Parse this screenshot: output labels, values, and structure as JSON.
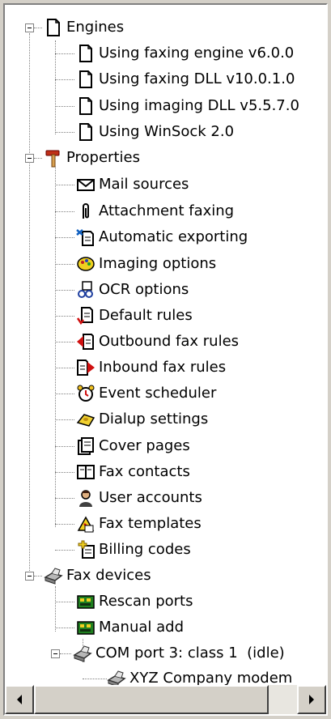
{
  "tree": {
    "engines": {
      "label": "Engines",
      "children": [
        {
          "label": "Using faxing engine v6.0.0",
          "icon": "document-icon"
        },
        {
          "label": "Using faxing DLL v10.0.1.0",
          "icon": "document-icon"
        },
        {
          "label": "Using imaging DLL v5.5.7.0",
          "icon": "document-icon"
        },
        {
          "label": "Using WinSock 2.0",
          "icon": "document-icon"
        }
      ]
    },
    "properties": {
      "label": "Properties",
      "children": [
        {
          "label": "Mail sources",
          "icon": "envelope-icon"
        },
        {
          "label": "Attachment faxing",
          "icon": "paperclip-icon"
        },
        {
          "label": "Automatic exporting",
          "icon": "export-icon"
        },
        {
          "label": "Imaging options",
          "icon": "imaging-icon"
        },
        {
          "label": "OCR options",
          "icon": "ocr-icon"
        },
        {
          "label": "Default rules",
          "icon": "rules-icon"
        },
        {
          "label": "Outbound fax rules",
          "icon": "outbound-icon"
        },
        {
          "label": "Inbound fax rules",
          "icon": "inbound-icon"
        },
        {
          "label": "Event scheduler",
          "icon": "alarm-clock-icon"
        },
        {
          "label": "Dialup settings",
          "icon": "telephone-icon"
        },
        {
          "label": "Cover pages",
          "icon": "cover-page-icon"
        },
        {
          "label": "Fax contacts",
          "icon": "address-book-icon"
        },
        {
          "label": "User accounts",
          "icon": "user-icon"
        },
        {
          "label": "Fax templates",
          "icon": "template-icon"
        },
        {
          "label": "Billing codes",
          "icon": "billing-icon"
        }
      ]
    },
    "fax_devices": {
      "label": "Fax devices",
      "children": [
        {
          "label": "Rescan ports",
          "icon": "circuit-board-icon"
        },
        {
          "label": "Manual add",
          "icon": "circuit-board-icon"
        }
      ],
      "port": {
        "label": "COM port 3: class 1  (idle)",
        "children": [
          {
            "label": "XYZ Company modem",
            "icon": "fax-machine-icon"
          }
        ]
      }
    }
  },
  "colors": {
    "panel_bg": "#ffffff",
    "chrome_bg": "#d4d0c8",
    "tree_line": "#808080"
  }
}
